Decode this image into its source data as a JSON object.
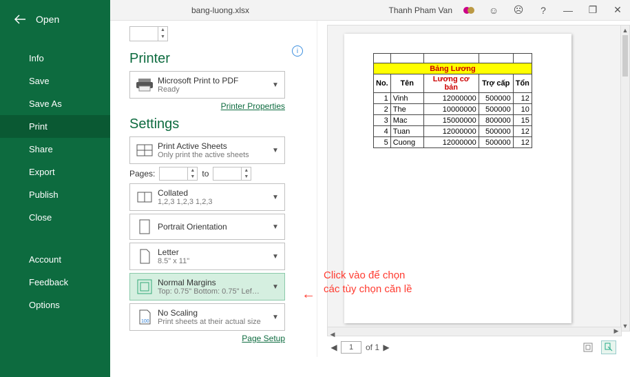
{
  "titlebar": {
    "doc_title": "bang-luong.xlsx",
    "user_name": "Thanh Pham Van",
    "help_symbol": "?",
    "minimize_symbol": "—",
    "restore_symbol": "❐",
    "close_symbol": "✕"
  },
  "sidebar": {
    "open_label": "Open",
    "items": [
      "Info",
      "Save",
      "Save As",
      "Print",
      "Share",
      "Export",
      "Publish",
      "Close"
    ],
    "lower_items": [
      "Account",
      "Feedback",
      "Options"
    ],
    "active_index": 3
  },
  "print": {
    "printer_heading": "Printer",
    "printer_name": "Microsoft Print to PDF",
    "printer_status": "Ready",
    "printer_props_link": "Printer Properties",
    "settings_heading": "Settings",
    "opt_active_sheets": {
      "t1": "Print Active Sheets",
      "t2": "Only print the active sheets"
    },
    "pages_label": "Pages:",
    "pages_to": "to",
    "opt_collated": {
      "t1": "Collated",
      "t2": "1,2,3    1,2,3    1,2,3"
    },
    "opt_orientation": {
      "t1": "Portrait Orientation",
      "t2": ""
    },
    "opt_paper": {
      "t1": "Letter",
      "t2": "8.5\" x 11\""
    },
    "opt_margins": {
      "t1": "Normal Margins",
      "t2": "Top: 0.75\" Bottom: 0.75\" Lef…"
    },
    "opt_scaling": {
      "t1": "No Scaling",
      "t2": "Print sheets at their actual size"
    },
    "page_setup_link": "Page Setup"
  },
  "preview": {
    "nav_page": "1",
    "nav_total": "of 1"
  },
  "chart_data": {
    "type": "table",
    "title": "Bảng Lương",
    "headers": [
      "No.",
      "Tên",
      "Lương cơ bản",
      "Trợ cấp",
      "Tổn"
    ],
    "rows": [
      {
        "no": "1",
        "ten": "Vinh",
        "luong": "12000000",
        "trocap": "500000",
        "ton": "12"
      },
      {
        "no": "2",
        "ten": "The",
        "luong": "10000000",
        "trocap": "500000",
        "ton": "10"
      },
      {
        "no": "3",
        "ten": "Mac",
        "luong": "15000000",
        "trocap": "800000",
        "ton": "15"
      },
      {
        "no": "4",
        "ten": "Tuan",
        "luong": "12000000",
        "trocap": "500000",
        "ton": "12"
      },
      {
        "no": "5",
        "ten": "Cuong",
        "luong": "12000000",
        "trocap": "500000",
        "ton": "12"
      }
    ]
  },
  "annotation": {
    "line1": "Click vào để chọn",
    "line2": "các tùy chọn căn lề",
    "arrow": "←"
  }
}
